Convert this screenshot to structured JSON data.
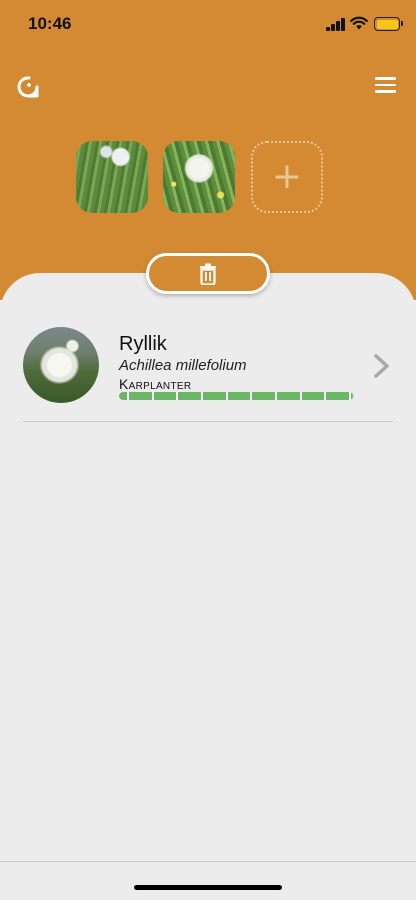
{
  "status_bar": {
    "time": "10:46",
    "signal_icon": "cellular-signal-icon",
    "wifi_icon": "wifi-icon",
    "battery_icon": "battery-icon",
    "battery_color": "#f5c518"
  },
  "header": {
    "background_color": "#d38a33",
    "refresh_icon": "refresh-icon",
    "menu_icon": "hamburger-menu-icon"
  },
  "photos": [
    {
      "name": "photo-thumbnail-1"
    },
    {
      "name": "photo-thumbnail-2"
    }
  ],
  "add_photo": {
    "symbol": "+",
    "icon": "plus-icon"
  },
  "delete_button": {
    "icon": "trash-icon"
  },
  "results": [
    {
      "common_name": "Ryllik",
      "latin_name": "Achillea millefolium",
      "group": "Karplanter",
      "confidence": 0.99,
      "confidence_color": "#6ab865"
    }
  ]
}
